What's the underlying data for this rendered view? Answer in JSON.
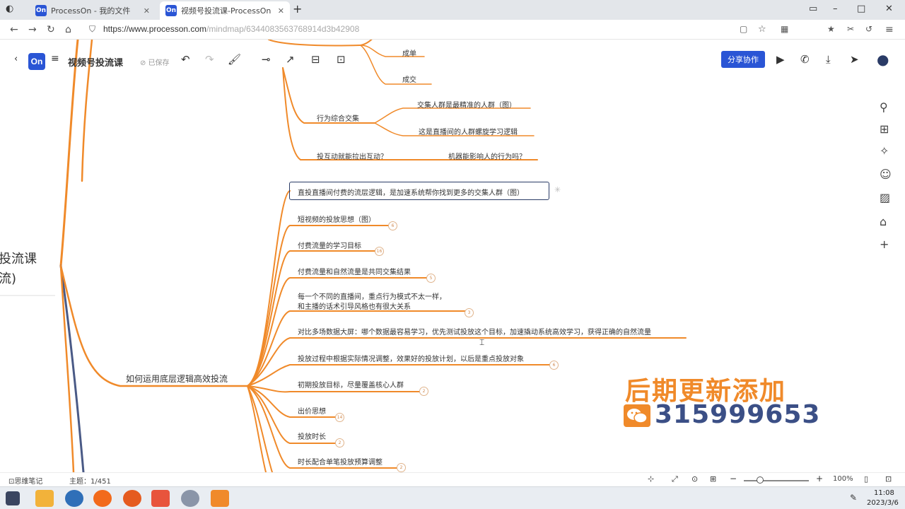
{
  "browser": {
    "tabs": [
      {
        "favicon": "On",
        "label": "ProcessOn - 我的文件"
      },
      {
        "favicon": "On",
        "label": "视频号投流课-ProcessOn"
      }
    ],
    "url_main": "https://www.processon.com",
    "url_rest": "/mindmap/6344083563768914d3b42908"
  },
  "app": {
    "logo": "On",
    "title": "视频号投流课",
    "save_status": "已保存",
    "share_label": "分享协作"
  },
  "mindmap": {
    "root_fragment": [
      "投流课",
      "流)"
    ],
    "branch": "如何运用底层逻辑高效投流",
    "top_nodes": {
      "n1": "成单",
      "n2": "成交",
      "behavior": "行为综合交集",
      "b1": "交集人群是最精准的人群（图）",
      "b2": "这是直播间的人群螺旋学习逻辑",
      "q1": "投互动就能拉出互动？",
      "q2": "机器能影响人的行为吗？"
    },
    "selected": "直投直播间付费的流层逻辑，是加速系统帮你找到更多的交集人群（图）",
    "children": [
      {
        "label": "短视频的投放思想（图）",
        "badge": "6"
      },
      {
        "label": "付费流量的学习目标",
        "badge": "16"
      },
      {
        "label": "付费流量和自然流量是共同交集结果",
        "badge": "5"
      },
      {
        "label": "每一个不同的直播间，重点行为模式不太一样，",
        "label2": "和主播的话术引导风格也有很大关系",
        "badge": "3"
      },
      {
        "label": "对比多场数据大屏：哪个数据最容易学习，优先测试投放这个目标，加速撬动系统高效学习，获得正确的自然流量",
        "badge": ""
      },
      {
        "label": "投放过程中根据实际情况调整，效果好的投放计划，以后是重点投放对象",
        "badge": "6"
      },
      {
        "label": "初期投放目标，尽量覆盖核心人群",
        "badge": "2"
      },
      {
        "label": "出价思想",
        "badge": "14"
      },
      {
        "label": "投放时长",
        "badge": "2"
      },
      {
        "label": "时长配合单笔投放预算调整",
        "badge": "2"
      }
    ]
  },
  "watermark": {
    "title": "后期更新添加",
    "number": "315999653"
  },
  "status": {
    "left": "思维笔记",
    "topic": "主题：1/451",
    "zoom": "100%"
  },
  "clock": {
    "time": "11:08",
    "date": "2023/3/6"
  },
  "colors": {
    "branch": "#f08a2a",
    "accent": "#2a55d5",
    "trunk": "#4a5a86"
  }
}
